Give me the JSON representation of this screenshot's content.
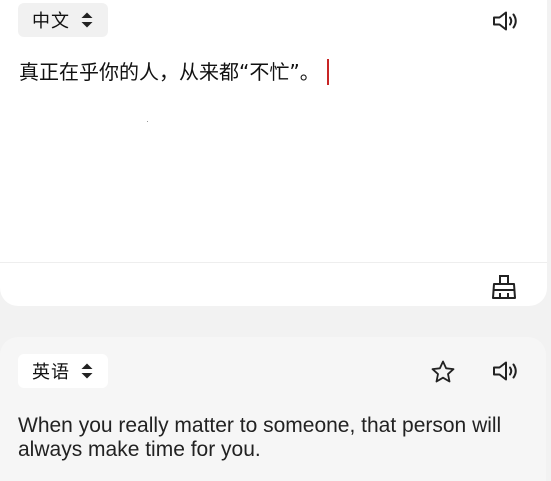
{
  "source": {
    "language": "中文",
    "text": "真正在乎你的人，从来都“不忙”。"
  },
  "target": {
    "language": "英语",
    "text": "When you really matter to someone, that person will always make time for you."
  },
  "icons": {
    "swap": "up-down-chevron-icon",
    "speaker": "speaker-icon",
    "clear": "eraser-icon",
    "favorite": "star-outline-icon"
  },
  "colors": {
    "caret": "#c82525",
    "text": "#111111"
  }
}
